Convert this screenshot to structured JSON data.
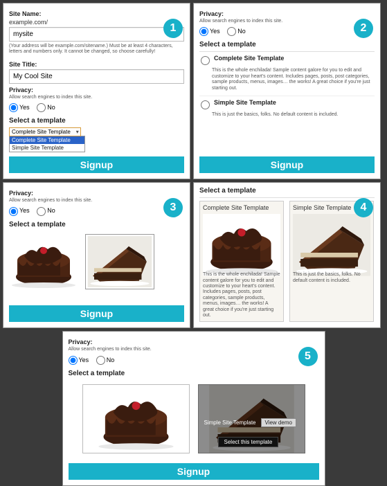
{
  "badges": {
    "p1": "1",
    "p2": "2",
    "p3": "3",
    "p4": "4",
    "p5": "5"
  },
  "labels": {
    "site_name": "Site Name:",
    "site_title": "Site Title:",
    "privacy": "Privacy:",
    "allow_search": "Allow search engines to index this site.",
    "yes": "Yes",
    "no": "No",
    "select_template": "Select a template"
  },
  "panel1": {
    "domain_prefix": "example.com/",
    "site_name_value": "mysite",
    "hint": "(Your address will be example.com/sitename.) Must be at least 4 characters, letters and numbers only. It cannot be changed, so choose carefully!",
    "site_title_value": "My Cool Site",
    "select_selected": "Complete Site Template",
    "dropdown": {
      "hi": "Complete Site Template",
      "item": "Simple Site Template"
    }
  },
  "panel2": {
    "complete": {
      "title": "Complete Site Template",
      "desc": "This is the whole enchilada! Sample content galore for you to edit and customize to your heart's content. Includes pages, posts, post categories, sample products, menus, images… the works! A great choice if you're just starting out."
    },
    "simple": {
      "title": "Simple Site Template",
      "desc": "This is just the basics, folks. No default content is included."
    }
  },
  "panel4": {
    "complete": {
      "title": "Complete Site Template",
      "desc": "This is the whole enchilada! Sample content galore for you to edit and customize to your heart's content. Includes pages, posts, post categories, sample products, menus, images… the works! A great choice if you're just starting out."
    },
    "simple": {
      "title": "Simple Site Template",
      "desc": "This is just the basics, folks. No default content is included."
    }
  },
  "panel5": {
    "overlay": {
      "label": "Simple Site Template",
      "view_demo": "View demo",
      "select": "Select this template"
    }
  },
  "signup": "Signup"
}
